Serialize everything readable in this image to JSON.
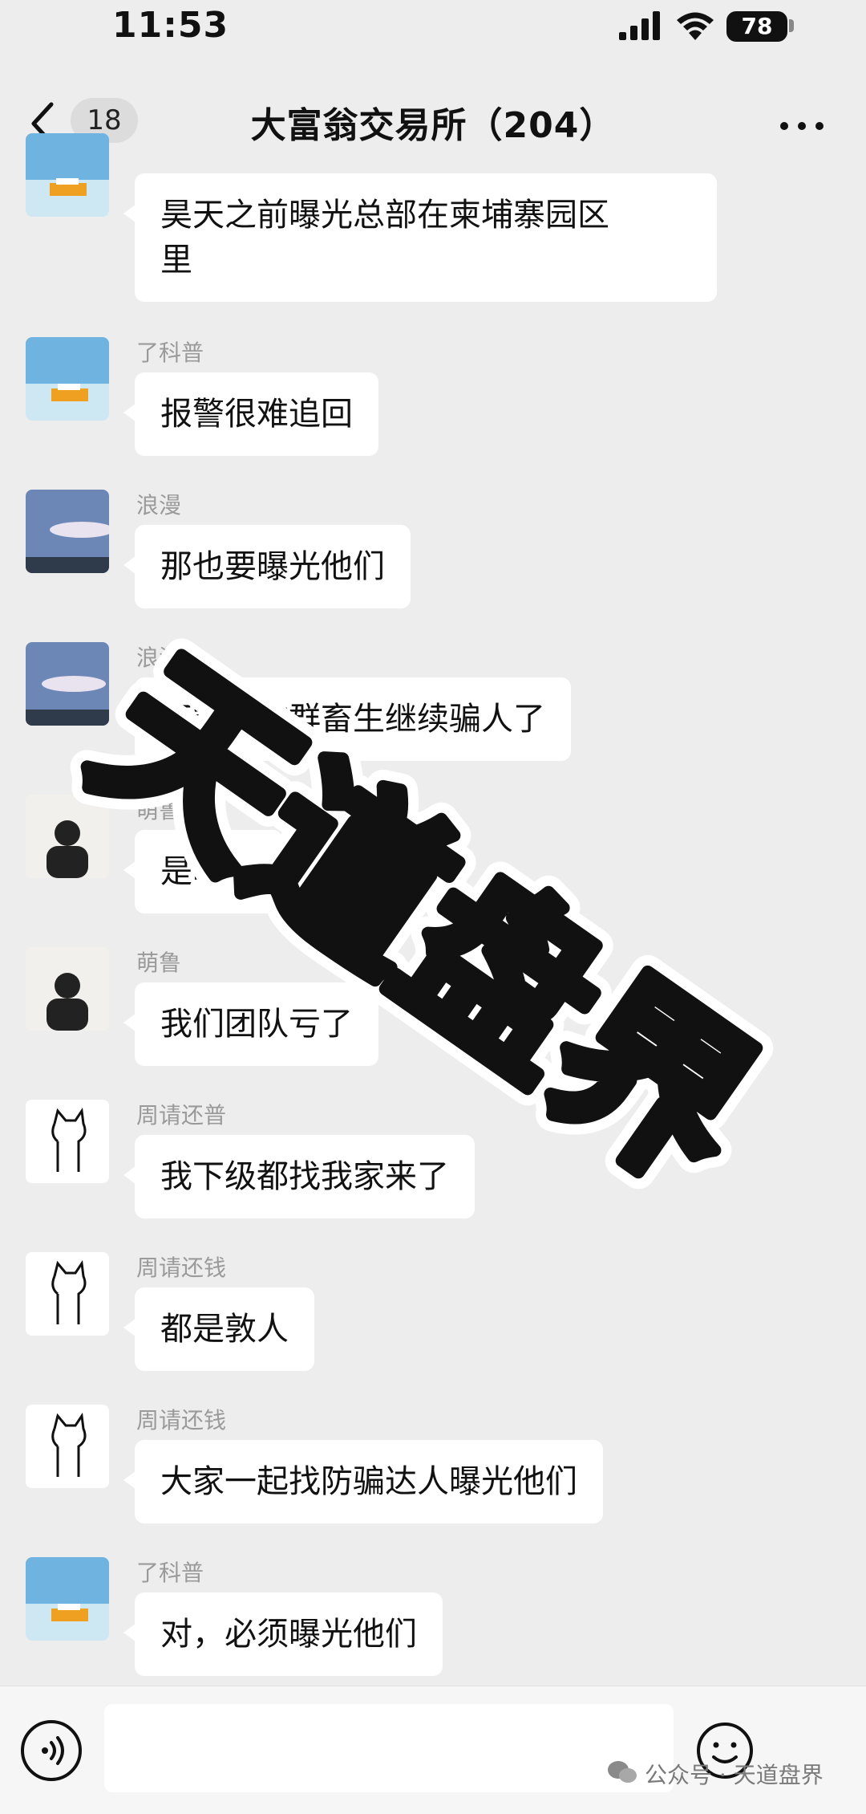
{
  "status_bar": {
    "time": "11:53",
    "battery": "78"
  },
  "nav": {
    "unread_count": "18",
    "title": "大富翁交易所（204）"
  },
  "messages": [
    {
      "sender": "",
      "text": "昊天之前曝光总部在柬埔寨园区\n里",
      "avatar": "boat-avatar"
    },
    {
      "sender": "了科普",
      "text": "报警很难追回",
      "avatar": "boat-avatar"
    },
    {
      "sender": "浪漫",
      "text": "那也要曝光他们",
      "avatar": "sky-avatar"
    },
    {
      "sender": "浪漫",
      "text": "不能让这群畜生继续骗人了",
      "avatar": "sky-avatar"
    },
    {
      "sender": "萌鲁",
      "text": "是啊，",
      "avatar": "person-avatar"
    },
    {
      "sender": "萌鲁",
      "text": "我们团队亏了",
      "avatar": "person-avatar"
    },
    {
      "sender": "周请还普",
      "text": "我下级都找我家来了",
      "avatar": "cat-avatar"
    },
    {
      "sender": "周请还钱",
      "text": "都是敦人",
      "avatar": "cat-avatar"
    },
    {
      "sender": "周请还钱",
      "text": "大家一起找防骗达人曝光他们",
      "avatar": "cat-avatar"
    },
    {
      "sender": "了科普",
      "text": "对，必须曝光他们",
      "avatar": "boat-avatar"
    }
  ],
  "watermark": {
    "overlay_text": "天道盘界",
    "footer": "公众号 · 天道盘界"
  }
}
